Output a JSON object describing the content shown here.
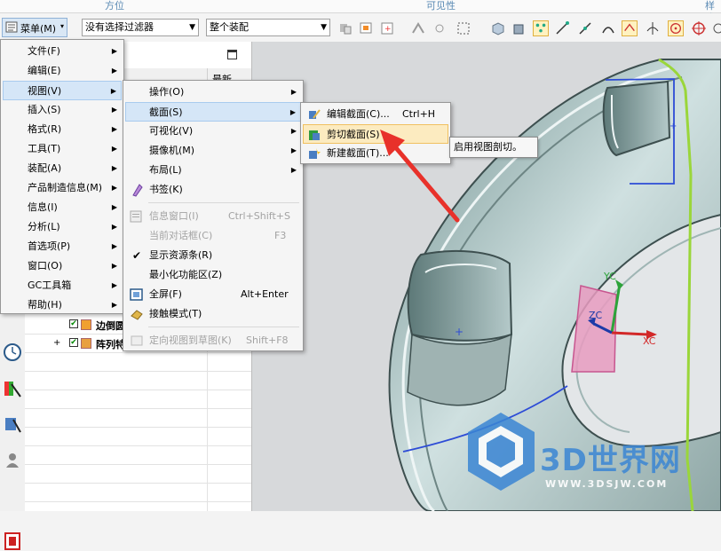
{
  "ribbon_groups": [
    "方位",
    "可见性",
    "样式"
  ],
  "toolbar": {
    "menu_button": "菜单(M)",
    "filter_value": "没有选择过滤器",
    "assembly_value": "整个装配"
  },
  "navigator": {
    "column_latest": "最新",
    "rows": [
      {
        "label": "边倒圆"
      },
      {
        "label": "阵列特"
      }
    ]
  },
  "main_menu": [
    {
      "label": "文件(F)",
      "submenu": true
    },
    {
      "label": "编辑(E)",
      "submenu": true
    },
    {
      "label": "视图(V)",
      "submenu": true,
      "highlighted": true
    },
    {
      "label": "插入(S)",
      "submenu": true
    },
    {
      "label": "格式(R)",
      "submenu": true
    },
    {
      "label": "工具(T)",
      "submenu": true
    },
    {
      "label": "装配(A)",
      "submenu": true
    },
    {
      "label": "产品制造信息(M)",
      "submenu": true
    },
    {
      "label": "信息(I)",
      "submenu": true
    },
    {
      "label": "分析(L)",
      "submenu": true
    },
    {
      "label": "首选项(P)",
      "submenu": true
    },
    {
      "label": "窗口(O)",
      "submenu": true
    },
    {
      "label": "GC工具箱",
      "submenu": true
    },
    {
      "label": "帮助(H)",
      "submenu": true
    }
  ],
  "view_menu": [
    {
      "label": "操作(O)",
      "submenu": true
    },
    {
      "label": "截面(S)",
      "submenu": true,
      "highlighted": true
    },
    {
      "label": "可视化(V)",
      "submenu": true
    },
    {
      "label": "摄像机(M)",
      "submenu": true
    },
    {
      "label": "布局(L)",
      "submenu": true
    },
    {
      "label": "书签(K)",
      "icon": "bookmark-icon"
    },
    {
      "label": "信息窗口(I)",
      "shortcut": "Ctrl+Shift+S",
      "disabled": true
    },
    {
      "label": "当前对话框(C)",
      "shortcut": "F3",
      "disabled": true
    },
    {
      "label": "显示资源条(R)",
      "checked": true
    },
    {
      "label": "最小化功能区(Z)"
    },
    {
      "label": "全屏(F)",
      "shortcut": "Alt+Enter",
      "icon": "fullscreen-icon"
    },
    {
      "label": "接触模式(T)",
      "icon": "touch-mode-icon"
    },
    {
      "label": "定向视图到草图(K)",
      "shortcut": "Shift+F8",
      "disabled": true
    }
  ],
  "section_menu": [
    {
      "label": "编辑截面(C)...",
      "shortcut": "Ctrl+H",
      "icon": "edit-section-icon"
    },
    {
      "label": "剪切截面(S)",
      "highlighted": true,
      "icon": "clip-section-icon"
    },
    {
      "label": "新建截面(T)...",
      "icon": "new-section-icon"
    }
  ],
  "tooltip": "启用视图剖切。",
  "axes": {
    "y": "YC",
    "z": "ZC",
    "x": "XC"
  },
  "watermark": {
    "title": "3D世界网",
    "url": "WWW.3DSJW.COM"
  },
  "colors": {
    "highlight_blue": "#d5e6f7",
    "highlight_yellow": "#fcebc0",
    "arrow_red": "#e8312a"
  }
}
